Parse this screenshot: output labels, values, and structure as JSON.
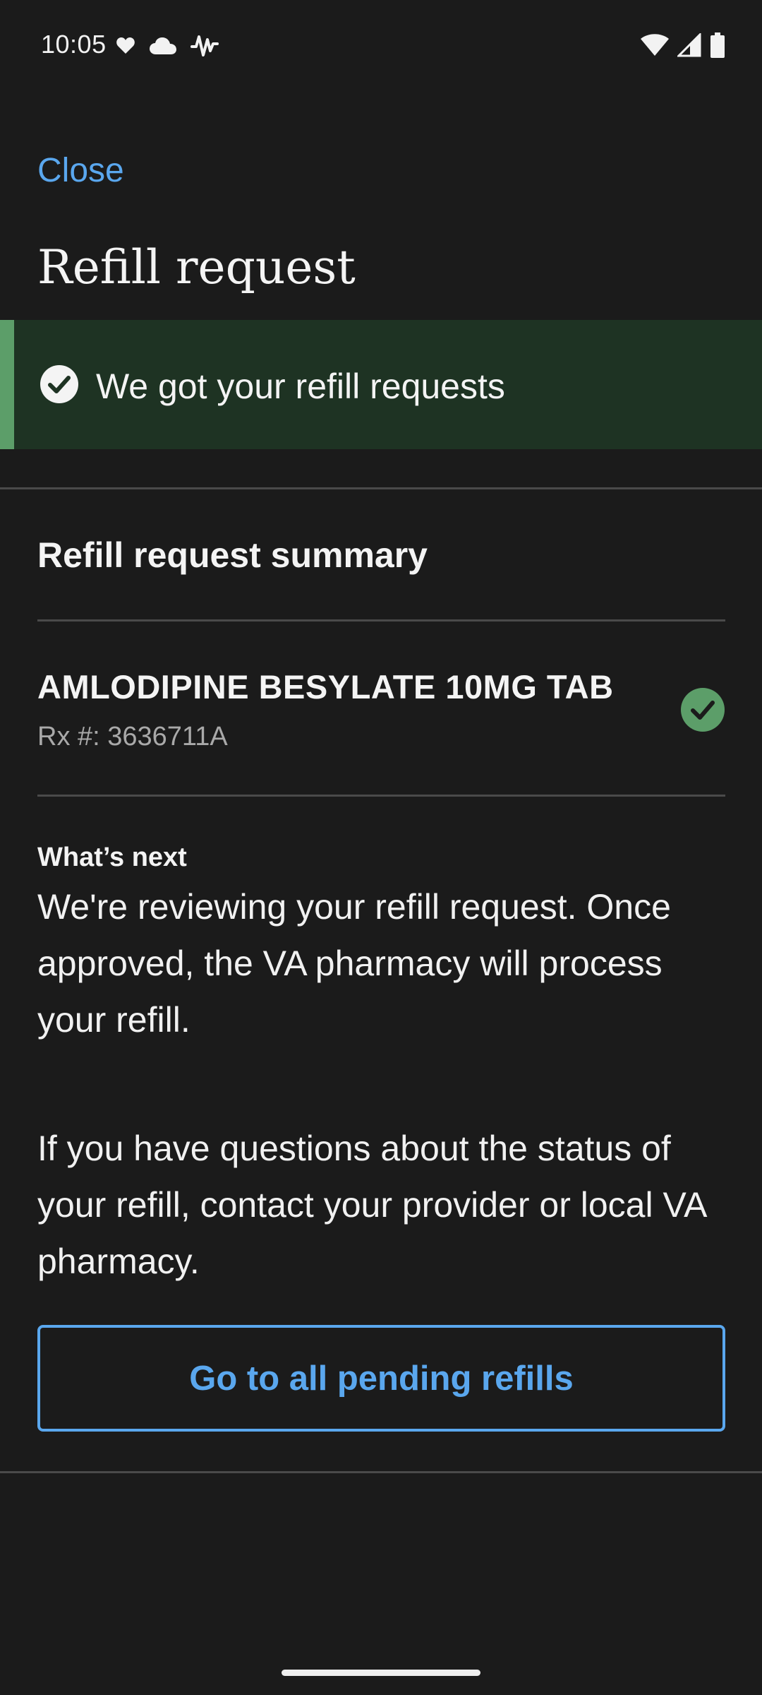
{
  "status_bar": {
    "time": "10:05",
    "icons": [
      "heart-icon",
      "cloud-icon",
      "activity-icon",
      "wifi-icon",
      "signal-icon",
      "battery-icon"
    ]
  },
  "header": {
    "close_label": "Close",
    "title": "Refill request"
  },
  "alert": {
    "message": "We got your refill requests",
    "icon": "check-circle-icon",
    "accent_color": "#5c9e69"
  },
  "summary": {
    "heading": "Refill request summary",
    "items": [
      {
        "name": "AMLODIPINE BESYLATE 10MG TAB",
        "rx": "Rx #: 3636711A",
        "status_icon": "check-circle-icon"
      }
    ]
  },
  "whats_next": {
    "label": "What’s next",
    "paragraph_1": "We're reviewing your refill request. Once approved, the VA pharmacy will process your refill.",
    "paragraph_2": "If you have questions about the status of your refill, contact your provider or local VA pharmacy."
  },
  "actions": {
    "pending_button_label": "Go to all pending refills"
  },
  "colors": {
    "background": "#1b1b1b",
    "link": "#5aa7ee",
    "success": "#5c9e69",
    "alert_background": "#1e3323"
  }
}
